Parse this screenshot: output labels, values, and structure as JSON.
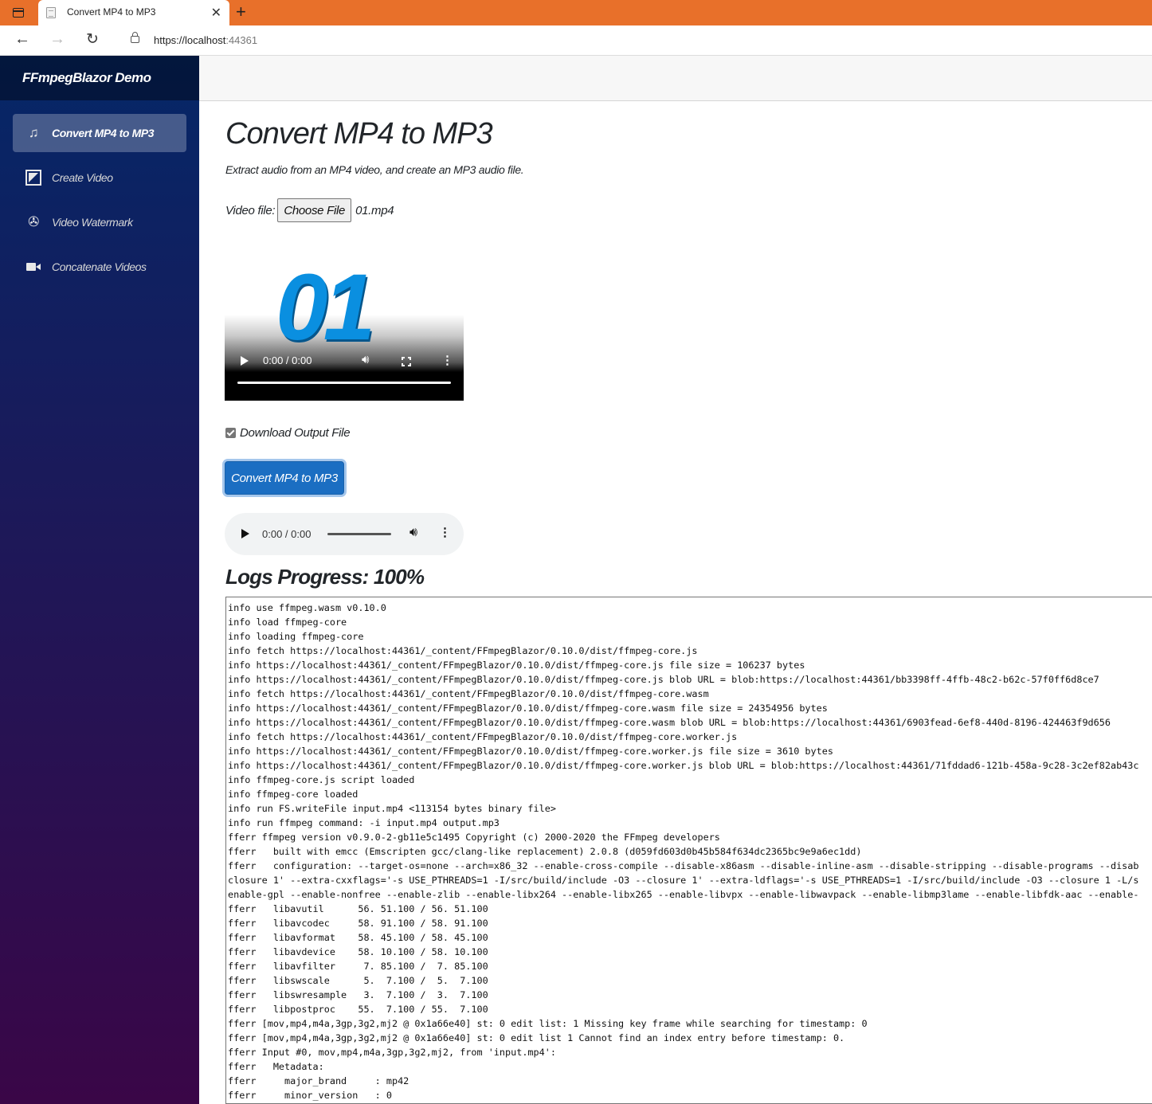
{
  "browser": {
    "tab_title": "Convert MP4 to MP3",
    "url_host": "https://localhost",
    "url_port": ":44361"
  },
  "sidebar": {
    "brand": "FFmpegBlazor Demo",
    "items": [
      {
        "label": "Convert MP4 to MP3",
        "icon": "music-note-icon",
        "active": true
      },
      {
        "label": "Create Video",
        "icon": "image-icon",
        "active": false
      },
      {
        "label": "Video Watermark",
        "icon": "aperture-icon",
        "active": false
      },
      {
        "label": "Concatenate Videos",
        "icon": "video-camera-icon",
        "active": false
      }
    ]
  },
  "main": {
    "title": "Convert MP4 to MP3",
    "subtitle": "Extract audio from an MP4 video, and create an MP3 audio file.",
    "video_file_label": "Video file:",
    "choose_file_label": "Choose File",
    "file_name": "01.mp4",
    "video_poster_text": "01",
    "video_time": "0:00 / 0:00",
    "download_label": "Download Output File",
    "download_checked": true,
    "convert_button": "Convert MP4 to MP3",
    "audio_time": "0:00 / 0:00",
    "logs_title": "Logs Progress: 100%",
    "logs": [
      "info use ffmpeg.wasm v0.10.0",
      "info load ffmpeg-core",
      "info loading ffmpeg-core",
      "info fetch https://localhost:44361/_content/FFmpegBlazor/0.10.0/dist/ffmpeg-core.js",
      "info https://localhost:44361/_content/FFmpegBlazor/0.10.0/dist/ffmpeg-core.js file size = 106237 bytes",
      "info https://localhost:44361/_content/FFmpegBlazor/0.10.0/dist/ffmpeg-core.js blob URL = blob:https://localhost:44361/bb3398ff-4ffb-48c2-b62c-57f0ff6d8ce7",
      "info fetch https://localhost:44361/_content/FFmpegBlazor/0.10.0/dist/ffmpeg-core.wasm",
      "info https://localhost:44361/_content/FFmpegBlazor/0.10.0/dist/ffmpeg-core.wasm file size = 24354956 bytes",
      "info https://localhost:44361/_content/FFmpegBlazor/0.10.0/dist/ffmpeg-core.wasm blob URL = blob:https://localhost:44361/6903fead-6ef8-440d-8196-424463f9d656",
      "info fetch https://localhost:44361/_content/FFmpegBlazor/0.10.0/dist/ffmpeg-core.worker.js",
      "info https://localhost:44361/_content/FFmpegBlazor/0.10.0/dist/ffmpeg-core.worker.js file size = 3610 bytes",
      "info https://localhost:44361/_content/FFmpegBlazor/0.10.0/dist/ffmpeg-core.worker.js blob URL = blob:https://localhost:44361/71fddad6-121b-458a-9c28-3c2ef82ab43c",
      "info ffmpeg-core.js script loaded",
      "info ffmpeg-core loaded",
      "info run FS.writeFile input.mp4 <113154 bytes binary file>",
      "info run ffmpeg command: -i input.mp4 output.mp3",
      "fferr ffmpeg version v0.9.0-2-gb11e5c1495 Copyright (c) 2000-2020 the FFmpeg developers",
      "fferr   built with emcc (Emscripten gcc/clang-like replacement) 2.0.8 (d059fd603d0b45b584f634dc2365bc9e9a6ec1dd)",
      "fferr   configuration: --target-os=none --arch=x86_32 --enable-cross-compile --disable-x86asm --disable-inline-asm --disable-stripping --disable-programs --disab",
      "closure 1' --extra-cxxflags='-s USE_PTHREADS=1 -I/src/build/include -O3 --closure 1' --extra-ldflags='-s USE_PTHREADS=1 -I/src/build/include -O3 --closure 1 -L/s",
      "enable-gpl --enable-nonfree --enable-zlib --enable-libx264 --enable-libx265 --enable-libvpx --enable-libwavpack --enable-libmp3lame --enable-libfdk-aac --enable-",
      "fferr   libavutil      56. 51.100 / 56. 51.100",
      "fferr   libavcodec     58. 91.100 / 58. 91.100",
      "fferr   libavformat    58. 45.100 / 58. 45.100",
      "fferr   libavdevice    58. 10.100 / 58. 10.100",
      "fferr   libavfilter     7. 85.100 /  7. 85.100",
      "fferr   libswscale      5.  7.100 /  5.  7.100",
      "fferr   libswresample   3.  7.100 /  3.  7.100",
      "fferr   libpostproc    55.  7.100 / 55.  7.100",
      "fferr [mov,mp4,m4a,3gp,3g2,mj2 @ 0x1a66e40] st: 0 edit list: 1 Missing key frame while searching for timestamp: 0",
      "fferr [mov,mp4,m4a,3gp,3g2,mj2 @ 0x1a66e40] st: 0 edit list 1 Cannot find an index entry before timestamp: 0.",
      "fferr Input #0, mov,mp4,m4a,3gp,3g2,mj2, from 'input.mp4':",
      "fferr   Metadata:",
      "fferr     major_brand     : mp42",
      "fferr     minor_version   : 0"
    ]
  }
}
